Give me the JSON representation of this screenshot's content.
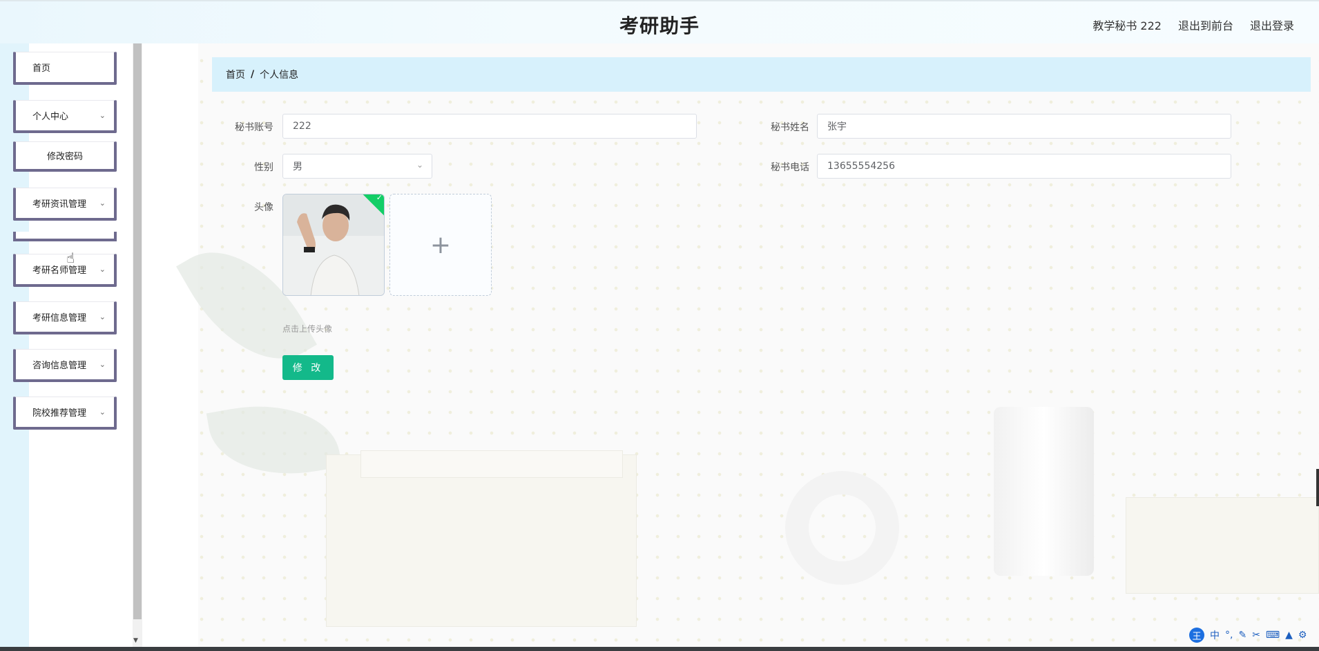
{
  "header": {
    "title": "考研助手",
    "user_label": "教学秘书 222",
    "back_front_label": "退出到前台",
    "logout_label": "退出登录"
  },
  "sidebar": {
    "items": [
      {
        "label": "首页",
        "chevron": false
      },
      {
        "label": "个人中心",
        "chevron": true
      },
      {
        "label": "修改密码",
        "chevron": false
      },
      {
        "label": "考研资讯管理",
        "chevron": true
      },
      {
        "label": "考研名师管理",
        "chevron": true
      },
      {
        "label": "考研信息管理",
        "chevron": true
      },
      {
        "label": "咨询信息管理",
        "chevron": true
      },
      {
        "label": "院校推荐管理",
        "chevron": true
      }
    ]
  },
  "breadcrumb": {
    "home": "首页",
    "separator": "/",
    "current": "个人信息"
  },
  "form": {
    "account_label": "秘书账号",
    "account_value": "222",
    "name_label": "秘书姓名",
    "name_value": "张宇",
    "gender_label": "性别",
    "gender_value": "男",
    "phone_label": "秘书电话",
    "phone_value": "13655554256",
    "avatar_label": "头像",
    "upload_plus": "+",
    "upload_tip": "点击上传头像",
    "submit_label": "修 改"
  },
  "ime": {
    "logo": "王",
    "mode": "中",
    "symbols": "°,"
  },
  "colors": {
    "accent": "#13b98a",
    "breadcrumb_bg": "#d7f1fc",
    "sidebar_border": "#6e6a8e",
    "check_badge": "#13ce66"
  }
}
